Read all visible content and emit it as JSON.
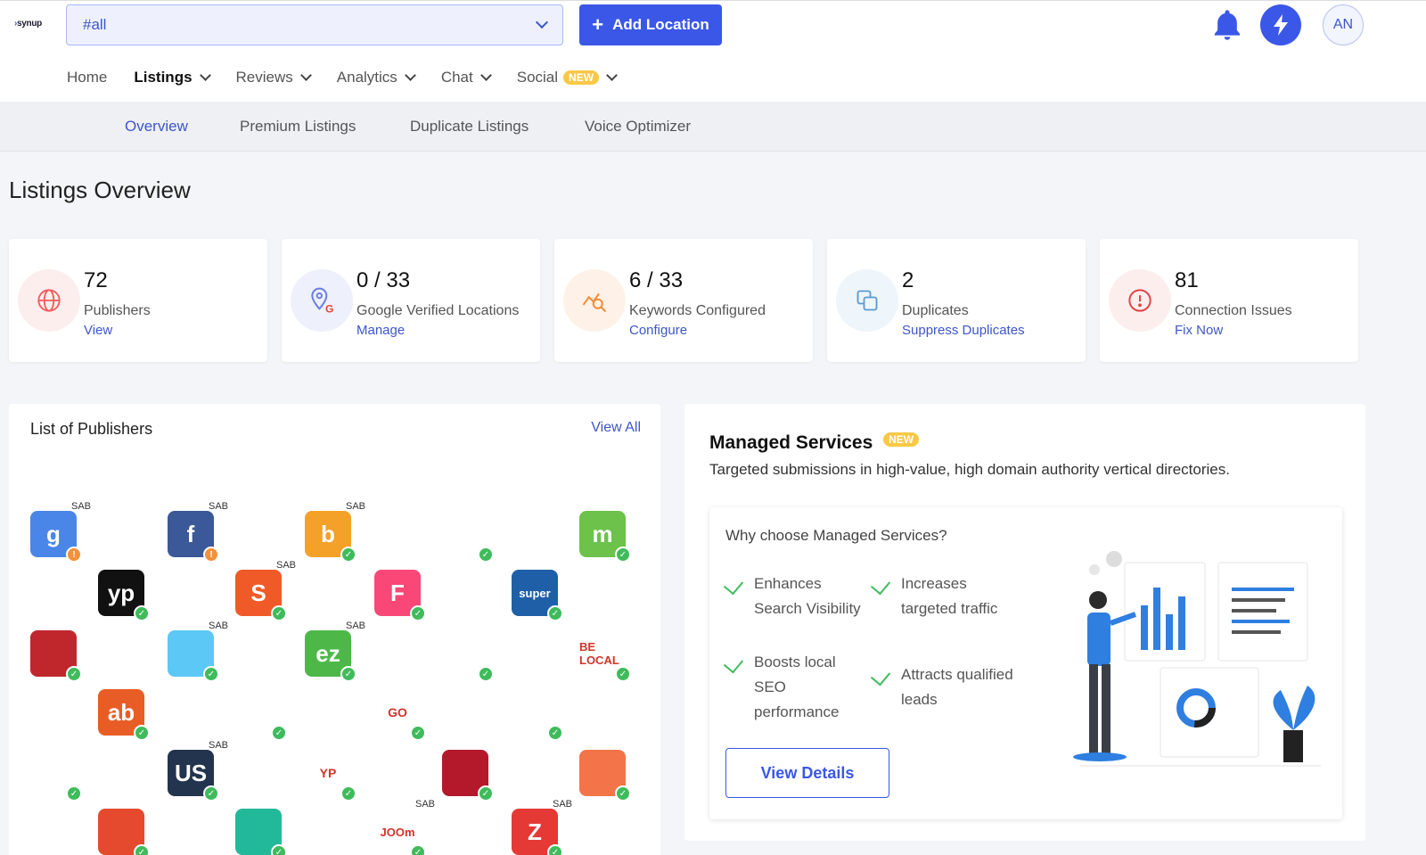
{
  "header": {
    "logo_text": "synup",
    "location_select_value": "#all",
    "add_location_label": "Add Location",
    "avatar_initials": "AN"
  },
  "main_nav": {
    "items": [
      {
        "label": "Home"
      },
      {
        "label": "Listings"
      },
      {
        "label": "Reviews"
      },
      {
        "label": "Analytics"
      },
      {
        "label": "Chat"
      },
      {
        "label": "Social",
        "badge": "NEW"
      }
    ]
  },
  "sub_nav": {
    "tabs": [
      {
        "label": "Overview"
      },
      {
        "label": "Premium Listings"
      },
      {
        "label": "Duplicate Listings"
      },
      {
        "label": "Voice Optimizer"
      }
    ]
  },
  "page": {
    "title": "Listings Overview"
  },
  "stats": [
    {
      "value": "72",
      "label": "Publishers",
      "link": "View",
      "icon": "globe-icon",
      "color": "#f25c5c"
    },
    {
      "value": "0 / 33",
      "label": "Google Verified Locations",
      "link": "Manage",
      "icon": "google-location-icon",
      "color": "#6b7fe0"
    },
    {
      "value": "6 / 33",
      "label": "Keywords Configured",
      "link": "Configure",
      "icon": "keyword-chart-icon",
      "color": "#f28b3a"
    },
    {
      "value": "2",
      "label": "Duplicates",
      "link": "Suppress Duplicates",
      "icon": "duplicate-icon",
      "color": "#5b9bd5"
    },
    {
      "value": "81",
      "label": "Connection Issues",
      "link": "Fix Now",
      "icon": "alert-icon",
      "color": "#e04646"
    }
  ],
  "publishers_panel": {
    "title": "List of Publishers",
    "view_all": "View All",
    "sab_label": "SAB",
    "publishers": [
      {
        "name": "google",
        "text": "g",
        "bg": "#4a86e8",
        "sab": true,
        "status": "warn"
      },
      {
        "name": "facebook",
        "text": "f",
        "bg": "#3b5998",
        "sab": true,
        "status": "warn"
      },
      {
        "name": "bing",
        "text": "b",
        "bg": "#f4a12a",
        "sab": true,
        "status": "ok"
      },
      {
        "name": "apple",
        "text": "",
        "bg": "#ffffff",
        "sab": false,
        "status": "ok"
      },
      {
        "name": "moz",
        "text": "m",
        "bg": "#6cc24a",
        "sab": false,
        "status": "ok"
      },
      {
        "name": "yellow-pages",
        "text": "yp",
        "bg": "#111111",
        "sab": false,
        "status": "ok"
      },
      {
        "name": "judysbook",
        "text": "S",
        "bg": "#f05a28",
        "sab": true,
        "status": "ok"
      },
      {
        "name": "foursquare",
        "text": "F",
        "bg": "#f94877",
        "sab": false,
        "status": "ok"
      },
      {
        "name": "superpages",
        "text": "super",
        "bg": "#1f5fa8",
        "sab": false,
        "status": "ok"
      },
      {
        "name": "merchant-circle",
        "text": "",
        "bg": "#c0272d",
        "sab": false,
        "status": "ok"
      },
      {
        "name": "chamber",
        "text": "",
        "bg": "#5bc8f5",
        "sab": true,
        "status": "ok"
      },
      {
        "name": "ezlocal",
        "text": "ez",
        "bg": "#4db848",
        "sab": true,
        "status": "ok"
      },
      {
        "name": "citysquares",
        "text": "",
        "bg": "#ffffff",
        "sab": false,
        "status": "ok"
      },
      {
        "name": "be-local-focused",
        "text": "BE LOCAL",
        "bg": "#ffffff",
        "sab": false,
        "status": "ok"
      },
      {
        "name": "abilogic",
        "text": "ab",
        "bg": "#e85d25",
        "sab": false,
        "status": "ok"
      },
      {
        "name": "citymaps",
        "text": "",
        "bg": "#ffffff",
        "sab": false,
        "status": "ok"
      },
      {
        "name": "golocal247",
        "text": "GO",
        "bg": "#ffffff",
        "sab": false,
        "status": "ok"
      },
      {
        "name": "find-local",
        "text": "",
        "bg": "#ffffff",
        "sab": false,
        "status": "ok"
      },
      {
        "name": "smart-business",
        "text": "",
        "bg": "#ffffff",
        "sab": false,
        "status": "ok"
      },
      {
        "name": "us-city",
        "text": "US",
        "bg": "#22344e",
        "sab": true,
        "status": "ok"
      },
      {
        "name": "yp-listing",
        "text": "YP",
        "bg": "#ffffff",
        "sab": false,
        "status": "ok"
      },
      {
        "name": "bizmetron",
        "text": "",
        "bg": "#b3192b",
        "sab": false,
        "status": "ok"
      },
      {
        "name": "cylex",
        "text": "",
        "bg": "#f27448",
        "sab": false,
        "status": "ok"
      },
      {
        "name": "n49",
        "text": "",
        "bg": "#e64a2e",
        "sab": false,
        "status": "ok"
      },
      {
        "name": "maps-pin",
        "text": "",
        "bg": "#22b99a",
        "sab": false,
        "status": "ok"
      },
      {
        "name": "joom-local",
        "text": "JOOm",
        "bg": "#ffffff",
        "sab": true,
        "status": "ok"
      },
      {
        "name": "zip",
        "text": "Z",
        "bg": "#e53935",
        "sab": true,
        "status": "ok"
      }
    ]
  },
  "managed_services": {
    "title": "Managed Services",
    "badge": "NEW",
    "description": "Targeted submissions in high-value, high domain authority vertical directories.",
    "question": "Why choose Managed Services?",
    "benefits": [
      "Enhances Search Visibility",
      "Boosts local SEO performance",
      "Increases targeted traffic",
      "Attracts qualified leads"
    ],
    "cta": "View Details"
  }
}
